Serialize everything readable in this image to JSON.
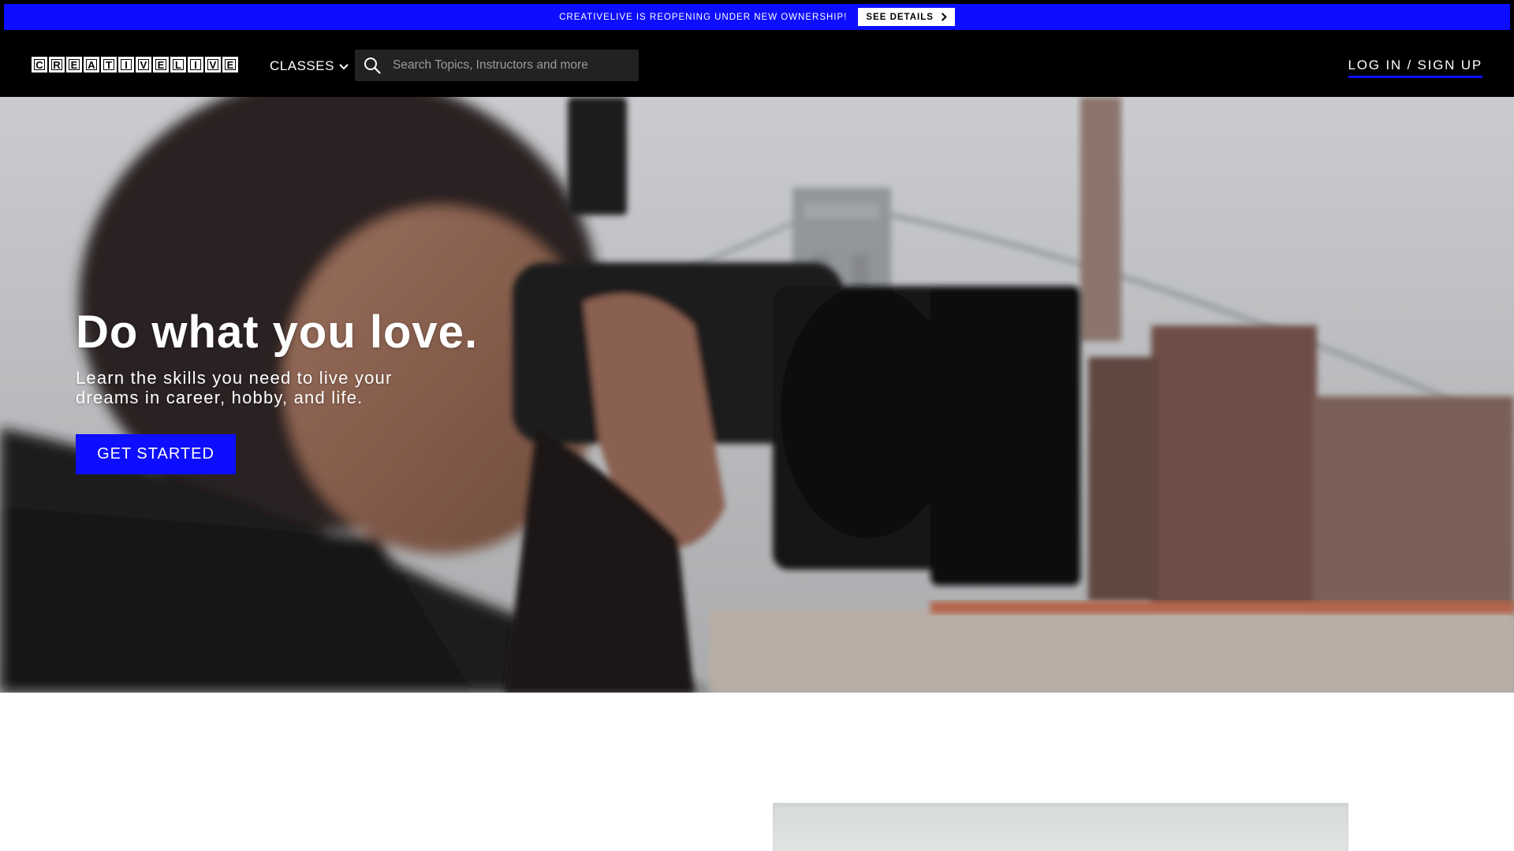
{
  "announcement": {
    "text": "CREATIVELIVE IS REOPENING UNDER NEW OWNERSHIP!",
    "button_label": "SEE DETAILS"
  },
  "header": {
    "logo_letters": [
      "C",
      "R",
      "E",
      "A",
      "T",
      "I",
      "V",
      "E",
      "L",
      "I",
      "V",
      "E"
    ],
    "classes_label": "CLASSES",
    "search_placeholder": "Search Topics, Instructors and more",
    "login_label": "LOG IN / SIGN UP"
  },
  "hero": {
    "title": "Do what you love.",
    "subtitle": "Learn the skills you need to live your dreams in career, hobby, and life.",
    "cta_label": "GET STARTED"
  },
  "colors": {
    "accent": "#0d0dff",
    "header_bg": "#000000",
    "search_bg": "#222222"
  },
  "icons": {
    "search": "search-icon",
    "classes_dropdown": "chevron-down-icon",
    "see_details": "chevron-right-icon"
  }
}
